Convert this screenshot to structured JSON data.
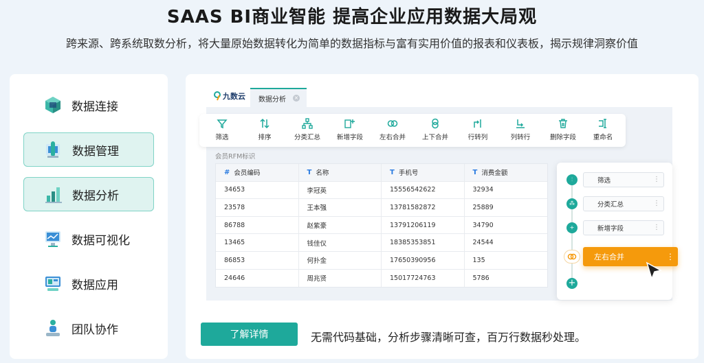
{
  "hero": {
    "title": "SAAS BI商业智能 提高企业应用数据大局观",
    "subtitle": "跨来源、跨系统取数分析，将大量原始数据转化为简单的数据指标与富有实用价值的报表和仪表板，揭示规律洞察价值"
  },
  "sidebar": {
    "items": [
      {
        "label": "数据连接",
        "icon": "database-cube-icon",
        "active": false
      },
      {
        "label": "数据管理",
        "icon": "data-management-icon",
        "active": true
      },
      {
        "label": "数据分析",
        "icon": "data-analysis-icon",
        "active": true
      },
      {
        "label": "数据可视化",
        "icon": "data-visualization-icon",
        "active": false
      },
      {
        "label": "数据应用",
        "icon": "data-application-icon",
        "active": false
      },
      {
        "label": "团队协作",
        "icon": "team-collaboration-icon",
        "active": false
      }
    ]
  },
  "app": {
    "logo": "九数云",
    "tab_label": "数据分析",
    "toolbar": [
      {
        "label": "筛选",
        "icon": "filter-icon"
      },
      {
        "label": "排序",
        "icon": "sort-icon"
      },
      {
        "label": "分类汇总",
        "icon": "group-summary-icon"
      },
      {
        "label": "新增字段",
        "icon": "add-field-icon"
      },
      {
        "label": "左右合并",
        "icon": "horizontal-merge-icon"
      },
      {
        "label": "上下合并",
        "icon": "vertical-merge-icon"
      },
      {
        "label": "行转列",
        "icon": "row-to-column-icon"
      },
      {
        "label": "列转行",
        "icon": "column-to-row-icon"
      },
      {
        "label": "删除字段",
        "icon": "delete-field-icon"
      },
      {
        "label": "重命名",
        "icon": "rename-icon"
      }
    ],
    "table_title": "会员RFM标识",
    "table": {
      "headers": [
        {
          "mark": "#",
          "label": "会员编码"
        },
        {
          "mark": "T",
          "label": "名称"
        },
        {
          "mark": "T",
          "label": "手机号"
        },
        {
          "mark": "T",
          "label": "消费金额"
        }
      ],
      "rows": [
        [
          "34653",
          "李冠英",
          "15556542622",
          "32934"
        ],
        [
          "23578",
          "王本强",
          "13781582872",
          "25889"
        ],
        [
          "86788",
          "赵紫豪",
          "13791206119",
          "34790"
        ],
        [
          "13465",
          "钱佳仪",
          "18385353851",
          "24544"
        ],
        [
          "86853",
          "何扑金",
          "17650390956",
          "135"
        ],
        [
          "24646",
          "周兆贤",
          "15017724763",
          "5786"
        ]
      ]
    },
    "steps": [
      {
        "label": "筛选",
        "icon": "filter-icon"
      },
      {
        "label": "分类汇总",
        "icon": "group-summary-icon"
      },
      {
        "label": "新增字段",
        "icon": "add-field-icon"
      }
    ],
    "active_step": {
      "label": "左右合并",
      "icon": "horizontal-merge-icon"
    }
  },
  "cta": {
    "button_label": "了解详情",
    "text": "无需代码基础，分析步骤清晰可查，百万行数据秒处理。"
  },
  "colors": {
    "accent": "#1ea99b",
    "active_step": "#f59a0c",
    "page_bg": "#eef4fa"
  }
}
